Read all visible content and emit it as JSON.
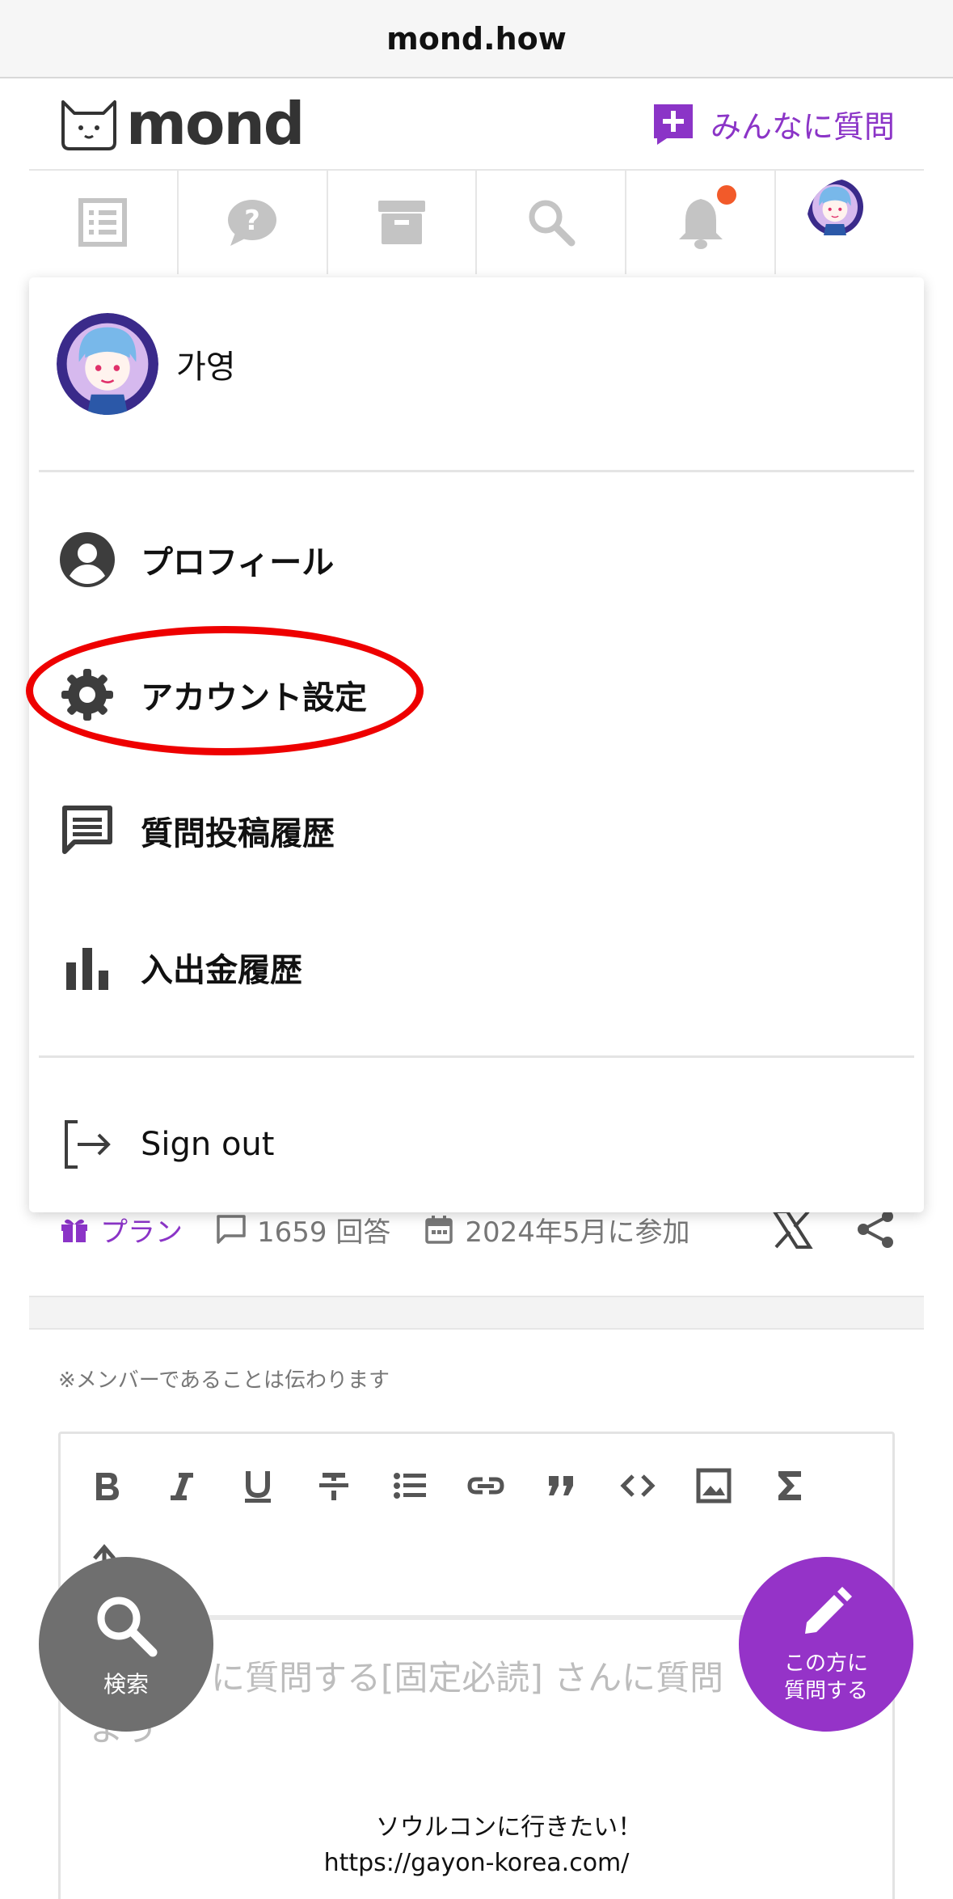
{
  "browser": {
    "url": "mond.how"
  },
  "header": {
    "logo_text": "mond",
    "ask_all_label": "みんなに質問"
  },
  "nav": {
    "items": [
      "list-icon",
      "question-icon",
      "archive-icon",
      "search-icon",
      "bell-icon",
      "avatar"
    ],
    "has_notification": true
  },
  "menu": {
    "user_name": "가영",
    "items": [
      {
        "label": "プロフィール",
        "icon": "account-circle-icon"
      },
      {
        "label": "アカウント設定",
        "icon": "gear-icon",
        "highlighted": true
      },
      {
        "label": "質問投稿履歴",
        "icon": "message-icon"
      },
      {
        "label": "入出金履歴",
        "icon": "bar-chart-icon"
      }
    ],
    "sign_out_label": "Sign out"
  },
  "profile": {
    "plan_label": "プラン",
    "answers": "1659 回答",
    "joined": "2024年5月に参加",
    "member_note": "※メンバーであることは伝わります"
  },
  "editor": {
    "placeholder": "に質問する[固定必読] さんに質問\nよう"
  },
  "fab": {
    "search_label": "検索",
    "ask_label_line1": "この方に",
    "ask_label_line2": "質問する"
  },
  "caption": {
    "line1": "ソウルコンに行きたい！",
    "line2": "https://gayon-korea.com/"
  },
  "colors": {
    "accent": "#8b34c7",
    "highlight": "#ee0000",
    "notification": "#f25a2a"
  }
}
